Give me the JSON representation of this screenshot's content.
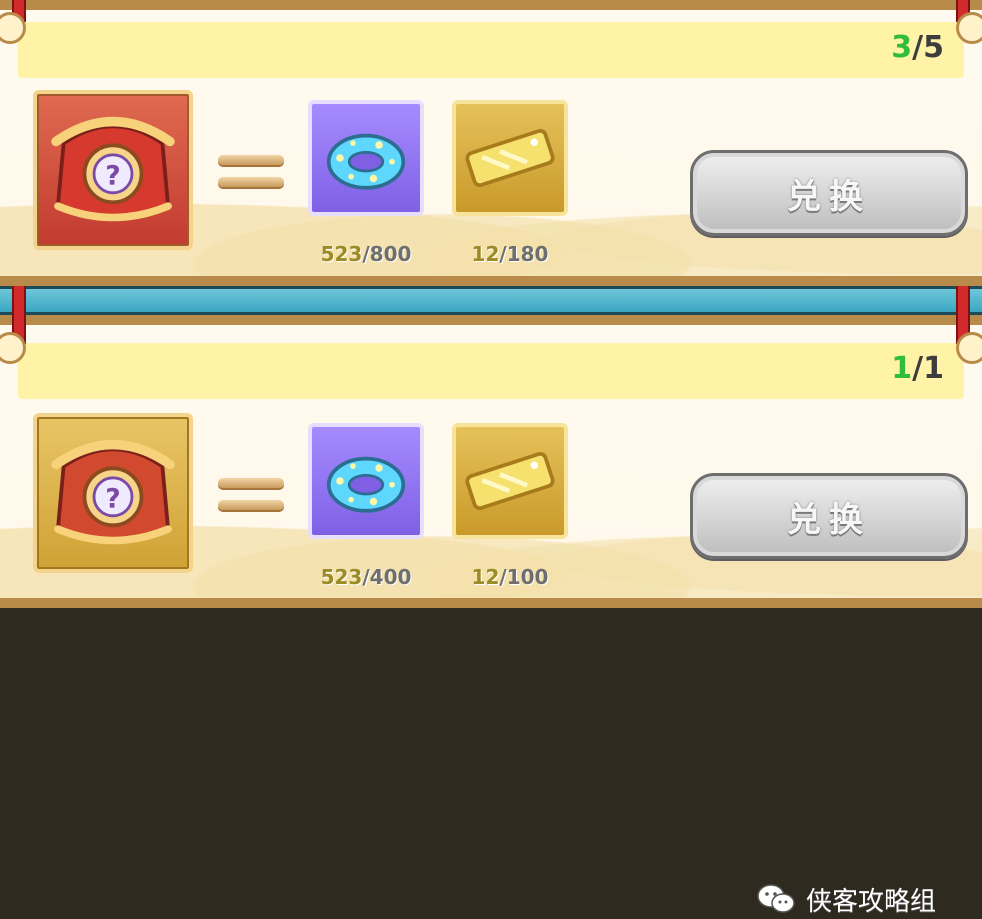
{
  "exchanges": [
    {
      "progress": {
        "have": "3",
        "total": "/5"
      },
      "reward": {
        "icon": "mystery-chest-red-icon"
      },
      "costs": [
        {
          "icon": "swim-ring-icon",
          "have": "523",
          "need": "/800",
          "color": "#8b6cf4"
        },
        {
          "icon": "golden-ticket-icon",
          "have": "12",
          "need": "/180",
          "color": "#d8b043"
        }
      ],
      "button_label": "兑换"
    },
    {
      "progress": {
        "have": "1",
        "total": "/1"
      },
      "reward": {
        "icon": "mystery-chest-gold-icon"
      },
      "costs": [
        {
          "icon": "swim-ring-icon",
          "have": "523",
          "need": "/400",
          "color": "#8b6cf4"
        },
        {
          "icon": "golden-ticket-icon",
          "have": "12",
          "need": "/100",
          "color": "#d8b043"
        }
      ],
      "button_label": "兑换"
    }
  ],
  "watermark": {
    "text": "侠客攻略组",
    "icon": "wechat-icon"
  },
  "colors": {
    "progress_have": "#2fbd3a",
    "frame": "#b88b4a",
    "divider": "#4cb6cd"
  }
}
